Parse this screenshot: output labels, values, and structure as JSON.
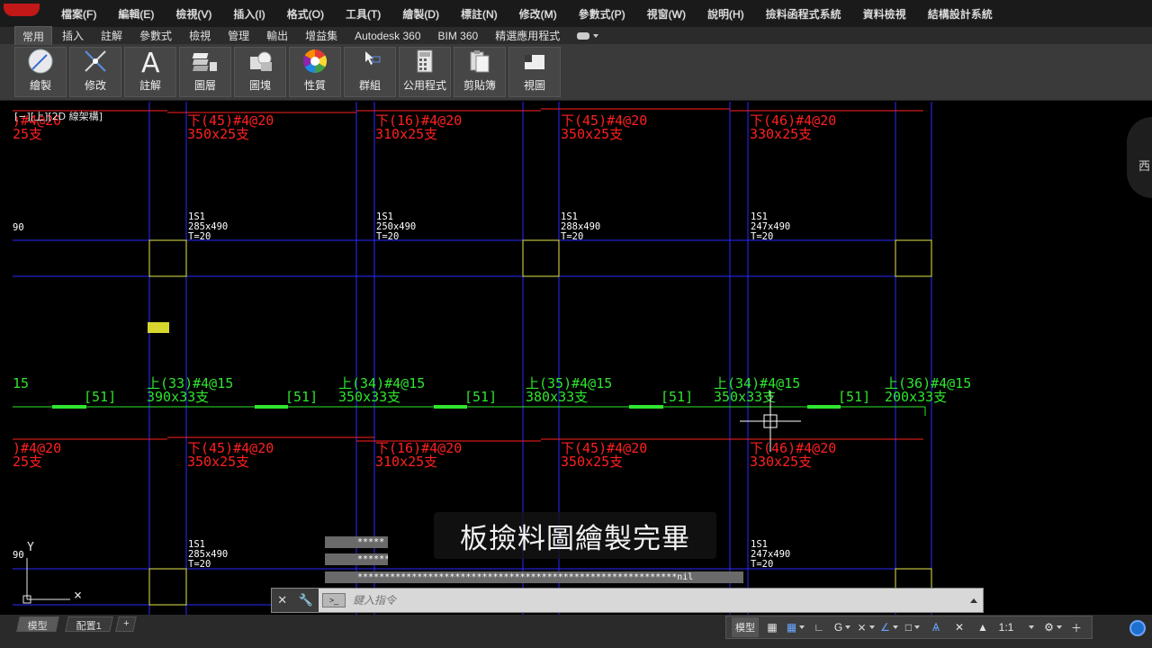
{
  "menu": {
    "items": [
      "檔案(F)",
      "編輯(E)",
      "檢視(V)",
      "插入(I)",
      "格式(O)",
      "工具(T)",
      "繪製(D)",
      "標註(N)",
      "修改(M)",
      "參數式(P)",
      "視窗(W)",
      "說明(H)",
      "撿料函程式系統",
      "資料檢視",
      "結構設計系統"
    ]
  },
  "ribbon": {
    "tabs": [
      "常用",
      "插入",
      "註解",
      "參數式",
      "檢視",
      "管理",
      "輸出",
      "增益集",
      "Autodesk 360",
      "BIM 360",
      "精選應用程式"
    ],
    "active_tab": "常用",
    "buttons": [
      {
        "label": "繪製",
        "icon": "draw-icon"
      },
      {
        "label": "修改",
        "icon": "modify-icon"
      },
      {
        "label": "註解",
        "icon": "annotation-icon"
      },
      {
        "label": "圖層",
        "icon": "layers-icon"
      },
      {
        "label": "圖塊",
        "icon": "block-icon"
      },
      {
        "label": "性質",
        "icon": "properties-icon"
      },
      {
        "label": "群組",
        "icon": "group-icon"
      },
      {
        "label": "公用程式",
        "icon": "calculator-icon"
      },
      {
        "label": "剪貼簿",
        "icon": "clipboard-icon"
      },
      {
        "label": "視圖",
        "icon": "view-icon"
      }
    ]
  },
  "viewport": {
    "label": "[−][上][2D 線架構]",
    "viewcube_text": "西"
  },
  "drawing": {
    "red_labels_top": [
      {
        "line1": "下(45)#4@20",
        "line2": "350x25支"
      },
      {
        "line1": "下(16)#4@20",
        "line2": "310x25支"
      },
      {
        "line1": "下(45)#4@20",
        "line2": "350x25支"
      },
      {
        "line1": "下(46)#4@20",
        "line2": "330x25支"
      }
    ],
    "red_labels_top_partial": {
      "line1": ")#4@20",
      "line2": "25支"
    },
    "red_labels_bottom": [
      {
        "line1": "下(45)#4@20",
        "line2": "350x25支"
      },
      {
        "line1": "下(16)#4@20",
        "line2": "310x25支"
      },
      {
        "line1": "下(45)#4@20",
        "line2": "350x25支"
      },
      {
        "line1": "下(46)#4@20",
        "line2": "330x25支"
      }
    ],
    "red_labels_bottom_partial": {
      "line1": ")#4@20",
      "line2": "25支"
    },
    "slab_labels_top": [
      {
        "name": "1S1",
        "size": "285x490",
        "t": "T=20"
      },
      {
        "name": "1S1",
        "size": "250x490",
        "t": "T=20"
      },
      {
        "name": "1S1",
        "size": "288x490",
        "t": "T=20"
      },
      {
        "name": "1S1",
        "size": "247x490",
        "t": "T=20"
      }
    ],
    "slab_labels_bottom": [
      {
        "name": "1S1",
        "size": "285x490",
        "t": "T=20"
      },
      {
        "name": "1S1",
        "size": "247x490",
        "t": "T=20"
      }
    ],
    "partial_90": "90",
    "green_labels": [
      {
        "line1": "上(33)#4@15",
        "line2": "390x33支"
      },
      {
        "line1": "上(34)#4@15",
        "line2": "350x33支"
      },
      {
        "line1": "上(35)#4@15",
        "line2": "380x33支"
      },
      {
        "line1": "上(34)#4@15",
        "line2": "350x33支"
      },
      {
        "line1": "上(36)#4@15",
        "line2": "200x33支"
      }
    ],
    "green_partial": "15",
    "bracket_tags": [
      "[51]",
      "[51]",
      "[51]",
      "[51]",
      "[51]"
    ]
  },
  "subtitle": "板撿料圖繪製完畢",
  "command": {
    "history": [
      "*****",
      "******",
      "***********************************************************nil"
    ],
    "placeholder": "鍵入指令"
  },
  "layout_tabs": [
    "模型",
    "配置1"
  ],
  "status": {
    "model_label": "模型",
    "scale": "1:1"
  },
  "colors": {
    "rebar_bottom": "#ff2020",
    "rebar_top": "#2fe52f",
    "grid": "#2a2aff",
    "column": "#e6e64a"
  }
}
